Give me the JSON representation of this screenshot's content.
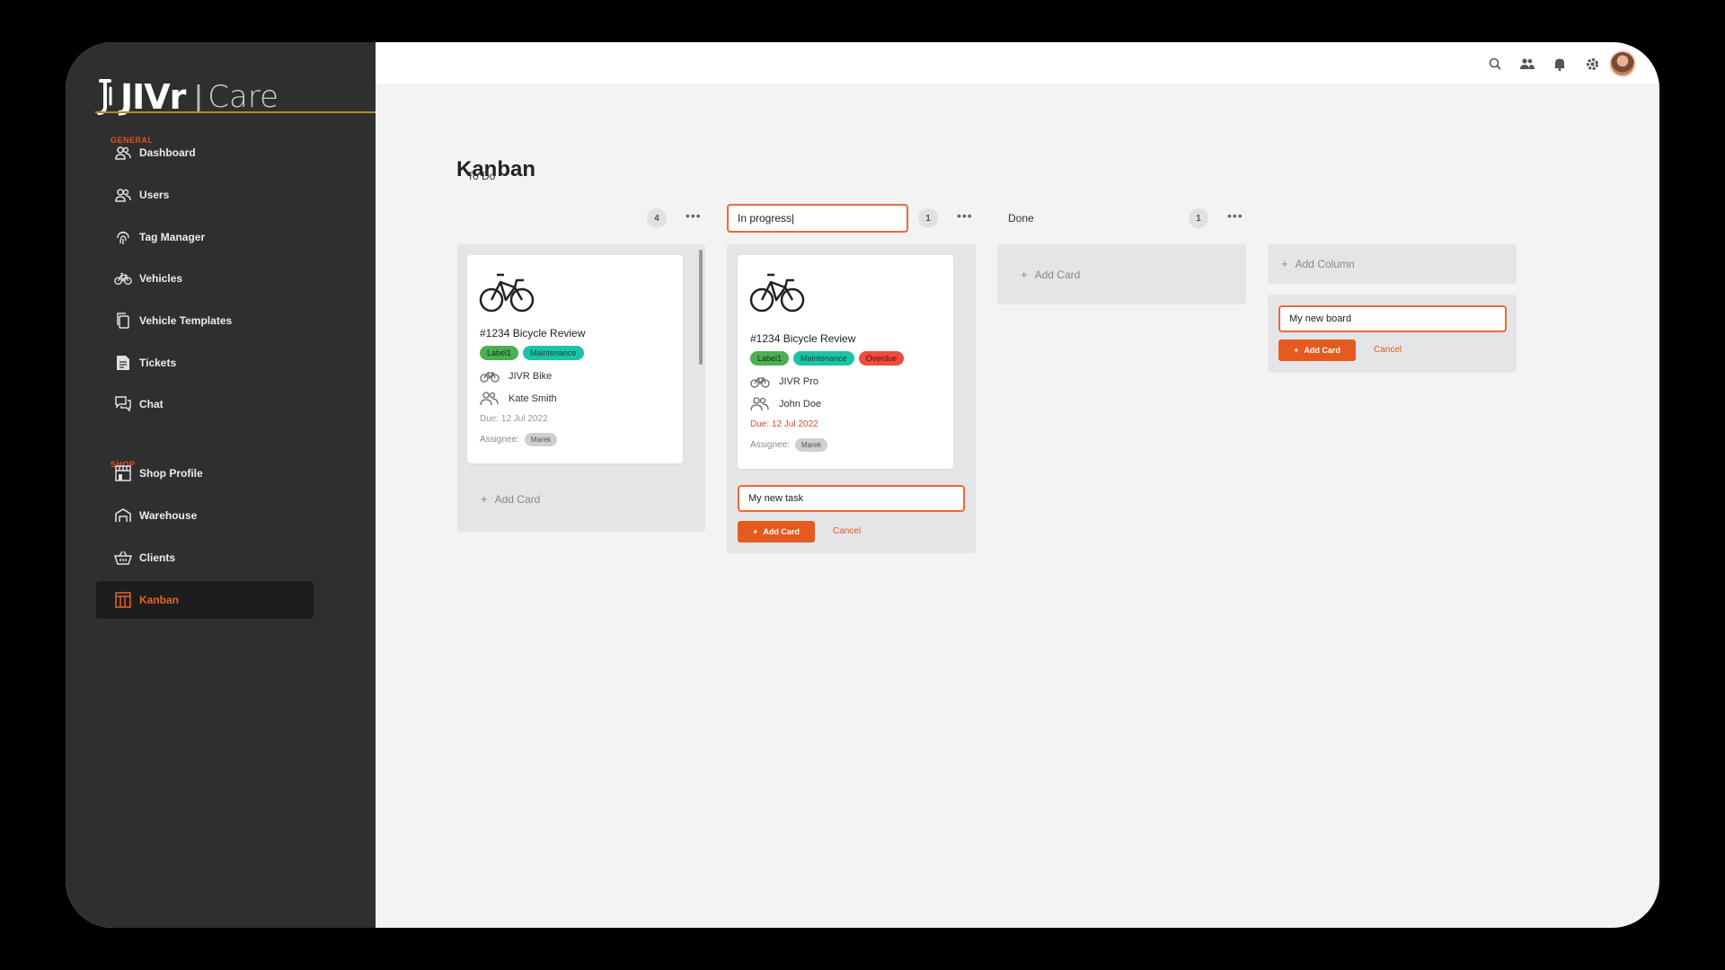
{
  "app": {
    "brand": "JIVr",
    "product": "Care",
    "separator": "|"
  },
  "sidebar": {
    "general_label": "General",
    "shop_label": "Shop",
    "items": [
      {
        "label": "Dashboard",
        "icon": "users-icon"
      },
      {
        "label": "Users",
        "icon": "users-icon"
      },
      {
        "label": "Tag Manager",
        "icon": "fingerprint-icon"
      },
      {
        "label": "Vehicles",
        "icon": "bicycle-icon"
      },
      {
        "label": "Vehicle Templates",
        "icon": "copy-icon"
      },
      {
        "label": "Tickets",
        "icon": "document-icon"
      },
      {
        "label": "Chat",
        "icon": "chat-icon"
      },
      {
        "label": "Shop Profile",
        "icon": "storefront-icon"
      },
      {
        "label": "Warehouse",
        "icon": "warehouse-icon"
      },
      {
        "label": "Clients",
        "icon": "basket-icon"
      },
      {
        "label": "Kanban",
        "icon": "kanban-icon",
        "active": true
      }
    ]
  },
  "topbar": {
    "icons": [
      "search-icon",
      "users-icon",
      "bell-icon",
      "gear-icon",
      "avatar"
    ]
  },
  "page": {
    "title": "Kanban"
  },
  "columns": [
    {
      "title": "To Do",
      "count": "4",
      "cards": [
        {
          "title": "#1234 Bicycle Review",
          "tags": [
            "Label1",
            "Maintenance"
          ],
          "vehicle": "JIVR Bike",
          "person": "Kate Smith",
          "due": "Due: 12 Jul 2022",
          "assignee_label": "Assignee:",
          "assignee": "Marek"
        }
      ],
      "add_card": "Add Card"
    },
    {
      "title_input": "In progress|",
      "count": "1",
      "cards": [
        {
          "title": "#1234 Bicycle Review",
          "tags": [
            "Label1",
            "Maintenance",
            "Overdue"
          ],
          "vehicle": "JIVR Pro",
          "person": "John Doe",
          "due": "Due: 12 Jul 2022",
          "assignee_label": "Assignee:",
          "assignee": "Marek"
        }
      ],
      "new_task_input": "My new task",
      "add_card_button": "Add Card",
      "cancel": "Cancel"
    },
    {
      "title": "Done",
      "count": "1",
      "add_card": "Add Card"
    }
  ],
  "new_column": {
    "add_column": "Add Column",
    "board_input": "My new board",
    "add_card_button": "Add Card",
    "cancel": "Cancel"
  },
  "colors": {
    "accent": "#e55a1e",
    "sidebar_bg": "#2f2f2f",
    "tag_green": "#4caf50",
    "tag_teal": "#1ec3a7",
    "tag_red": "#ee4b3c"
  }
}
